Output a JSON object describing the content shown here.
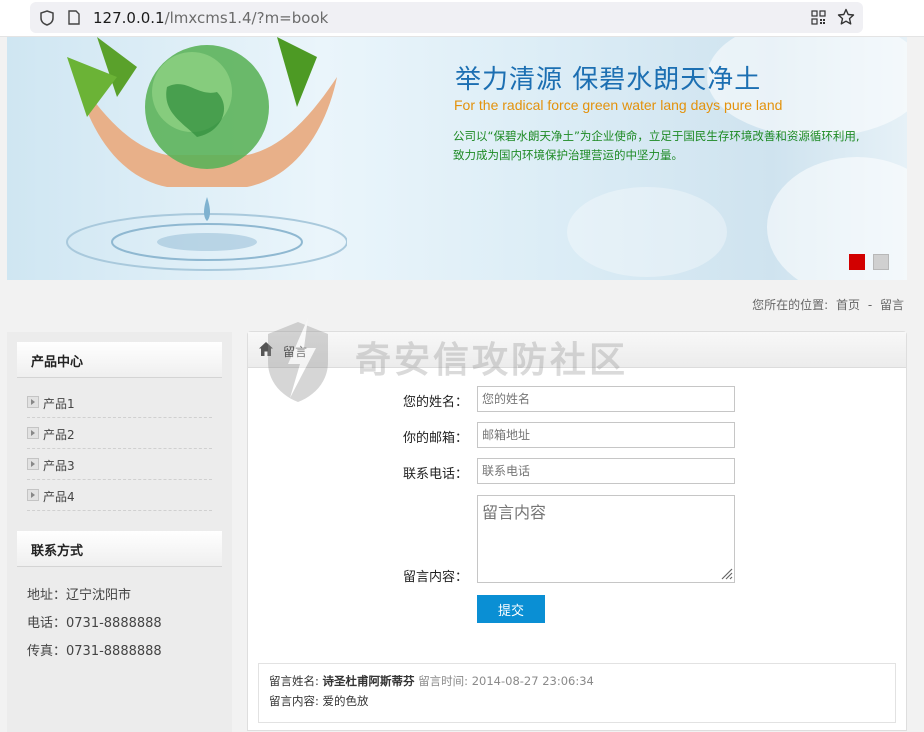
{
  "browser": {
    "url_host": "127.0.0.1",
    "url_path": "/lmxcms1.4/?m=book"
  },
  "banner": {
    "title": "举力清源 保碧水朗天净土",
    "subtitle": "For the radical force green water lang days pure land",
    "desc_line1": "公司以“保碧水朗天净土”为企业使命，立足于国民生存环境改善和资源循环利用,",
    "desc_line2": "致力成为国内环境保护治理营运的中坚力量。"
  },
  "breadcrumb": {
    "prefix": "您所在的位置:",
    "home": "首页",
    "sep": "-",
    "current": "留言"
  },
  "sidebar": {
    "product_title": "产品中心",
    "products": [
      {
        "label": "产品1"
      },
      {
        "label": "产品2"
      },
      {
        "label": "产品3"
      },
      {
        "label": "产品4"
      }
    ],
    "contact_title": "联系方式",
    "address": "地址：辽宁沈阳市",
    "phone": "电话：0731-8888888",
    "fax": "传真：0731-8888888"
  },
  "main": {
    "title": "留言",
    "watermark": "奇安信攻防社区",
    "form": {
      "name_label": "您的姓名：",
      "name_placeholder": "您的姓名",
      "email_label": "你的邮箱：",
      "email_placeholder": "邮箱地址",
      "phone_label": "联系电话：",
      "phone_placeholder": "联系电话",
      "content_label": "留言内容：",
      "content_placeholder": "留言内容",
      "submit_label": "提交"
    },
    "message": {
      "name_key": "留言姓名:",
      "name_value": "诗圣杜甫阿斯蒂芬",
      "time_key": "留言时间:",
      "time_value": "2014-08-27 23:06:34",
      "content_key": "留言内容:",
      "content_value": "爱的色放"
    }
  }
}
